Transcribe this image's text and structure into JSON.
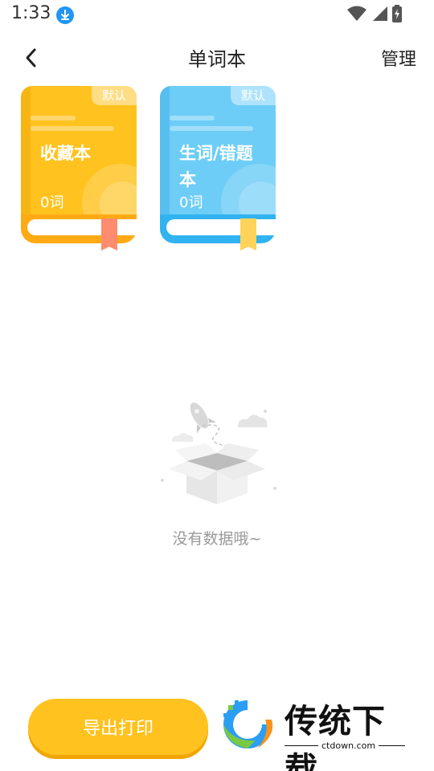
{
  "status_bar": {
    "time": "1:33",
    "icons": [
      "download-icon",
      "wifi-icon",
      "signal-icon",
      "battery-icon"
    ]
  },
  "header": {
    "back_icon": "chevron-left-icon",
    "title": "单词本",
    "manage_label": "管理"
  },
  "books": [
    {
      "badge": "默认",
      "name": "收藏本",
      "count": "0词",
      "color": "#ffc21f"
    },
    {
      "badge": "默认",
      "name": "生词/错题本",
      "count": "0词",
      "color": "#6dcdf7"
    }
  ],
  "empty_state": {
    "icon": "empty-box-icon",
    "text": "没有数据哦~"
  },
  "footer": {
    "export_label": "导出打印",
    "accent": "#ffc21f"
  },
  "watermark": {
    "name": "传统下载",
    "url": "ctdown.com"
  }
}
